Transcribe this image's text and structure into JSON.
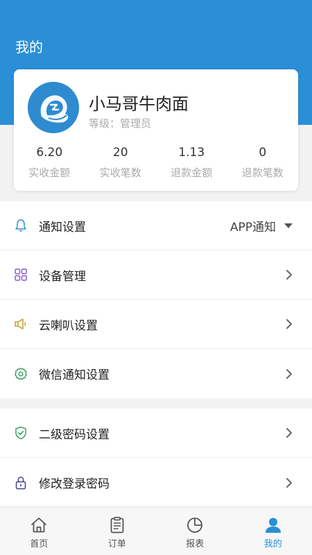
{
  "header": {
    "title": "我的"
  },
  "profile": {
    "name": "小马哥牛肉面",
    "role_line": "等级：管理员",
    "stats": [
      {
        "value": "6.20",
        "label": "实收金额"
      },
      {
        "value": "20",
        "label": "实收笔数"
      },
      {
        "value": "1.13",
        "label": "退款金额"
      },
      {
        "value": "0",
        "label": "退款笔数"
      }
    ]
  },
  "menu_group1": [
    {
      "icon": "bell-icon",
      "label": "通知设置",
      "value": "APP通知"
    },
    {
      "icon": "grid-icon",
      "label": "设备管理"
    },
    {
      "icon": "speaker-icon",
      "label": "云喇叭设置"
    },
    {
      "icon": "gear-icon",
      "label": "微信通知设置"
    }
  ],
  "menu_group2": [
    {
      "icon": "shield-check-icon",
      "label": "二级密码设置"
    },
    {
      "icon": "lock-icon",
      "label": "修改登录密码"
    }
  ],
  "tabbar": [
    {
      "icon": "home-icon",
      "label": "首页",
      "active": false
    },
    {
      "icon": "clipboard-icon",
      "label": "订单",
      "active": false
    },
    {
      "icon": "pie-chart-icon",
      "label": "报表",
      "active": false
    },
    {
      "icon": "person-icon",
      "label": "我的",
      "active": true
    }
  ],
  "colors": {
    "primary": "#2b8fd6",
    "page_bg": "#f2f2f2",
    "grid_icon": "#8a5bc7",
    "speaker_icon": "#c99a2e",
    "gear_icon": "#3a9a5c",
    "shield_icon": "#3aa05a",
    "lock_icon": "#3a3f99"
  }
}
